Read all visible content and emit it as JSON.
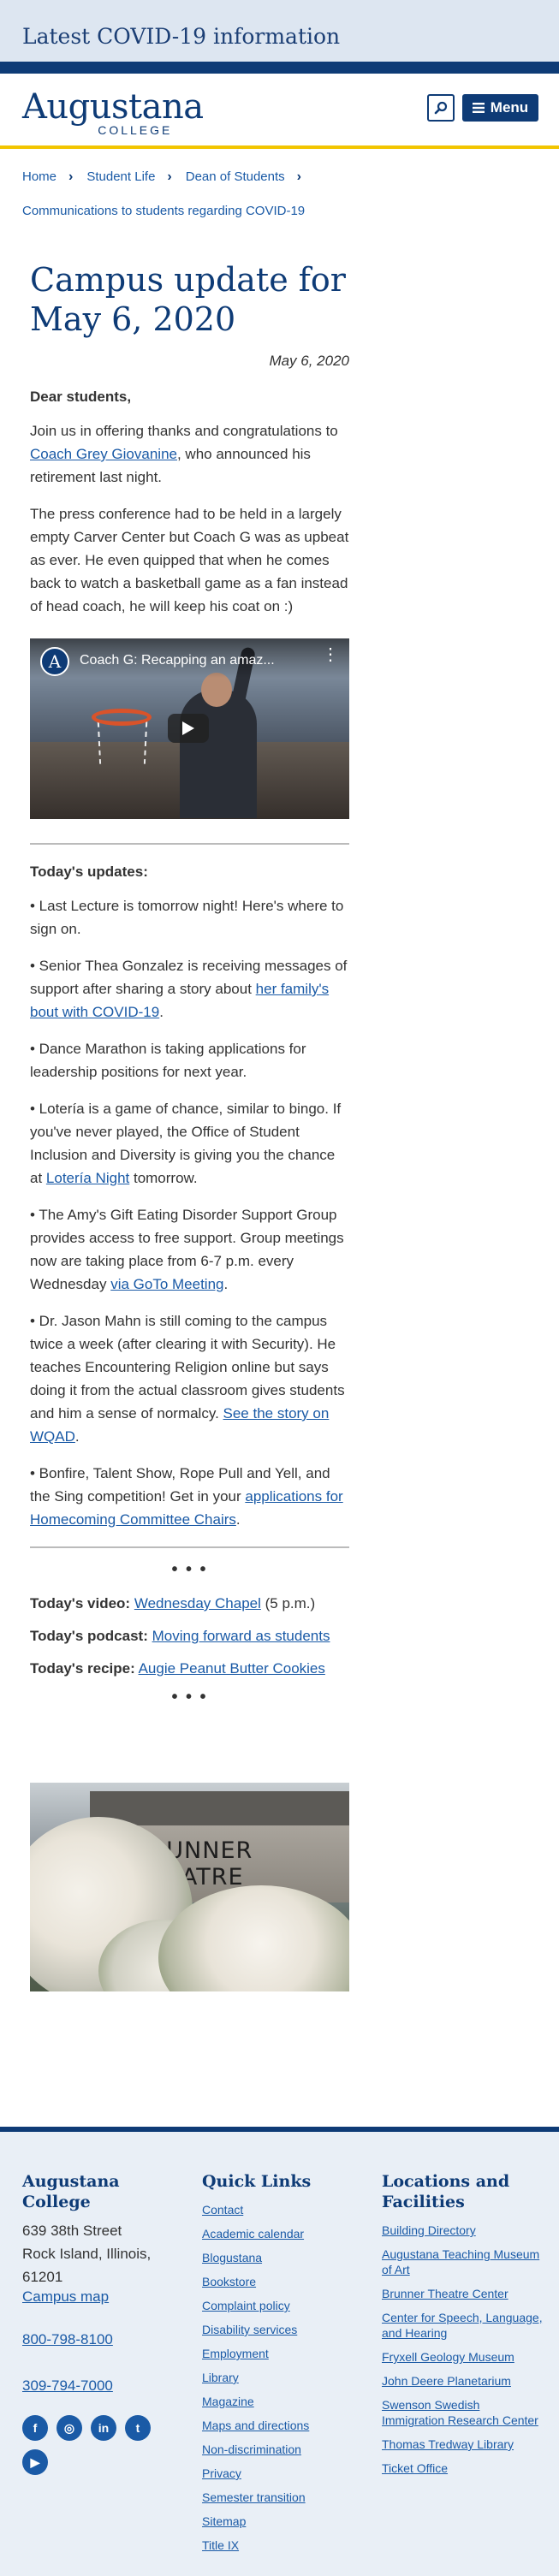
{
  "covid_banner": {
    "text": "Latest COVID-19 information"
  },
  "header": {
    "logo_main": "Augustana",
    "logo_sub": "COLLEGE",
    "menu_label": "Menu"
  },
  "breadcrumb": {
    "items": [
      "Home",
      "Student Life",
      "Dean of Students",
      "Communications to students regarding COVID-19"
    ]
  },
  "article": {
    "title": "Campus update for May 6, 2020",
    "date": "May 6, 2020",
    "salutation": "Dear students,",
    "p1_before": "Join us in offering thanks and congratulations to ",
    "p1_link": "Coach Grey Giovanine",
    "p1_after": ", who announced his retirement last night.",
    "p2": "The press conference had to be held in a largely empty Carver Center but Coach G was as upbeat as ever. He even quipped that when he comes back to watch a basketball game as a fan instead of head coach, he will keep his coat on :)",
    "video_title": "Coach G: Recapping an amaz...",
    "video_avatar": "A"
  },
  "updates": {
    "heading": "Today's updates:",
    "u1": "• Last Lecture is tomorrow night! Here's where to sign on.",
    "u2_before": "• Senior Thea Gonzalez is receiving messages of support after sharing a story about ",
    "u2_link": "her family's bout with COVID-19",
    "u2_after": ".",
    "u3": "• Dance Marathon is taking applications for leadership positions for next year.",
    "u4_before": "• Lotería is a game of chance, similar to bingo. If you've never played, the Office of Student Inclusion and Diversity is giving you the chance at ",
    "u4_link": "Lotería Night",
    "u4_after": " tomorrow.",
    "u5_before": "• The Amy's Gift Eating Disorder Support Group provides access to free support. Group meetings now are taking place from 6-7 p.m. every Wednesday ",
    "u5_link": "via GoTo Meeting",
    "u5_after": ".",
    "u6_before": "• Dr. Jason Mahn is still coming to the campus twice a week (after clearing it with Security). He teaches Encountering Religion online but says doing it from the actual classroom gives students and him a sense of normalcy. ",
    "u6_link": "See the story on WQAD",
    "u6_after": ".",
    "u7_before": "• Bonfire, Talent Show, Rope Pull and Yell, and the Sing competition! Get in your ",
    "u7_link": "applications for Homecoming Committee Chairs",
    "u7_after": "."
  },
  "daily": {
    "dots": "• • •",
    "video_label": "Today's video:",
    "video_link": "Wednesday Chapel",
    "video_after": " (5 p.m.)",
    "podcast_label": "Today's podcast:",
    "podcast_link": "Moving forward as students",
    "recipe_label": "Today's recipe:",
    "recipe_link": "Augie Peanut Butter Cookies"
  },
  "photo": {
    "sign_text": "BRUNNER THEATRE"
  },
  "footer": {
    "col1": {
      "heading": "Augustana College",
      "address_line1": "639 38th Street",
      "address_line2": "Rock Island, Illinois,",
      "address_line3": "61201",
      "map_link": "Campus map",
      "phone1": "800-798-8100",
      "phone2": "309-794-7000"
    },
    "col2": {
      "heading": "Quick Links",
      "links": [
        "Contact",
        "Academic calendar",
        "Blogustana",
        "Bookstore",
        "Complaint policy",
        "Disability services",
        "Employment",
        "Library",
        "Magazine",
        "Maps and directions",
        "Non-discrimination",
        "Privacy",
        "Semester transition",
        "Sitemap",
        "Title IX"
      ]
    },
    "col3": {
      "heading": "Locations and Facilities",
      "links": [
        "Building Directory",
        "Augustana Teaching Museum of Art",
        "Brunner Theatre Center",
        "Center for Speech, Language, and Hearing",
        "Fryxell Geology Museum",
        "John Deere Planetarium",
        "Swenson Swedish Immigration Research Center",
        "Thomas Tredway Library",
        "Ticket Office"
      ]
    },
    "social_icons": [
      "facebook-icon",
      "instagram-icon",
      "linkedin-icon",
      "twitter-icon",
      "youtube-icon"
    ],
    "social_glyphs": [
      "f",
      "◎",
      "in",
      "t",
      "▶"
    ]
  }
}
